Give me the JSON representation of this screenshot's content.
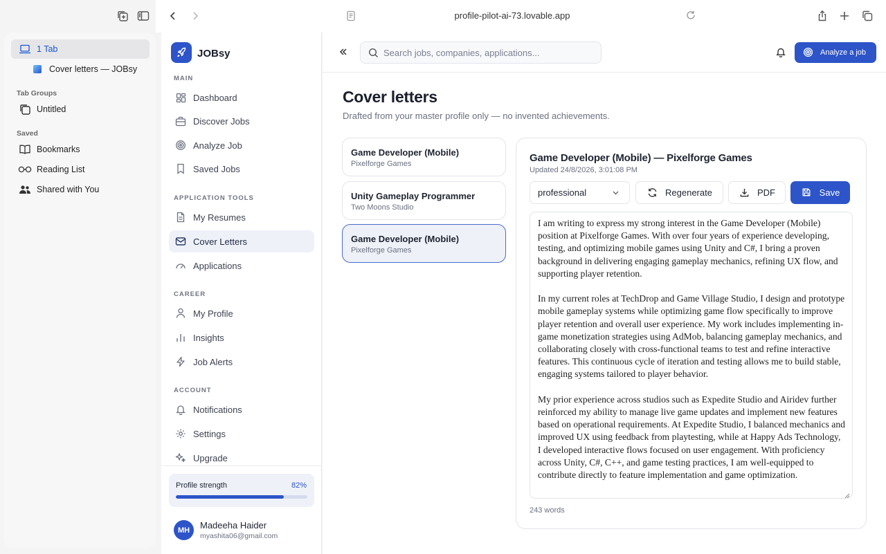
{
  "browser": {
    "url": "profile-pilot-ai-73.lovable.app"
  },
  "safari_sidebar": {
    "tab_count": "1 Tab",
    "tabs": [
      {
        "label": "Cover letters — JOBsy"
      }
    ],
    "tab_groups_heading": "Tab Groups",
    "tab_groups": [
      {
        "label": "Untitled"
      }
    ],
    "saved_heading": "Saved",
    "saved": [
      {
        "label": "Bookmarks",
        "icon": "book-icon"
      },
      {
        "label": "Reading List",
        "icon": "glasses-icon"
      },
      {
        "label": "Shared with You",
        "icon": "people-icon"
      }
    ]
  },
  "app": {
    "brand": "JOBsy",
    "sections": {
      "main": "MAIN",
      "tools": "APPLICATION TOOLS",
      "career": "CAREER",
      "account": "ACCOUNT"
    },
    "nav": {
      "dashboard": "Dashboard",
      "discover": "Discover Jobs",
      "analyze": "Analyze Job",
      "saved": "Saved Jobs",
      "resumes": "My Resumes",
      "cover_letters": "Cover Letters",
      "applications": "Applications",
      "profile": "My Profile",
      "insights": "Insights",
      "alerts": "Job Alerts",
      "notifications": "Notifications",
      "settings": "Settings",
      "upgrade": "Upgrade"
    },
    "active_nav": "cover_letters",
    "profile_strength": {
      "label": "Profile strength",
      "value_text": "82%",
      "value": 0.82
    },
    "user": {
      "initials": "MH",
      "name": "Madeeha Haider",
      "email": "myashita06@gmail.com"
    },
    "colors": {
      "accent": "#2d54c8"
    }
  },
  "header": {
    "search_placeholder": "Search jobs, companies, applications...",
    "analyze_button": "Analyze a job"
  },
  "page": {
    "title": "Cover letters",
    "subtitle": "Drafted from your master profile only — no invented achievements."
  },
  "letters": [
    {
      "title": "Game Developer (Mobile)",
      "company": "Pixelforge Games",
      "active": false
    },
    {
      "title": "Unity Gameplay Programmer",
      "company": "Two Moons Studio",
      "active": false
    },
    {
      "title": "Game Developer (Mobile)",
      "company": "Pixelforge Games",
      "active": true
    }
  ],
  "editor": {
    "title": "Game Developer (Mobile) — Pixelforge Games",
    "updated": "Updated 24/8/2026, 3:01:08 PM",
    "tone": "professional",
    "regenerate": "Regenerate",
    "pdf": "PDF",
    "save": "Save",
    "paragraphs": [
      "I am writing to express my strong interest in the Game Developer (Mobile) position at Pixelforge Games. With over four years of experience developing, testing, and optimizing mobile games using Unity and C#, I bring a proven background in delivering engaging gameplay mechanics, refining UX flow, and supporting player retention.",
      "In my current roles at TechDrop and Game Village Studio, I design and prototype mobile gameplay systems while optimizing game flow specifically to improve player retention and overall user experience. My work includes implementing in-game monetization strategies using AdMob, balancing gameplay mechanics, and collaborating closely with cross-functional teams to test and refine interactive features. This continuous cycle of iteration and testing allows me to build stable, engaging systems tailored to player behavior.",
      "My prior experience across studios such as Expedite Studio and Airidev further reinforced my ability to manage live game updates and implement new features based on operational requirements. At Expedite Studio, I balanced mechanics and improved UX using feedback from playtesting, while at Happy Ads Technology, I developed interactive flows focused on user engagement. With proficiency across Unity, C#, C++, and game testing practices, I am well-equipped to contribute directly to feature implementation and game optimization."
    ],
    "word_count": "243 words"
  }
}
